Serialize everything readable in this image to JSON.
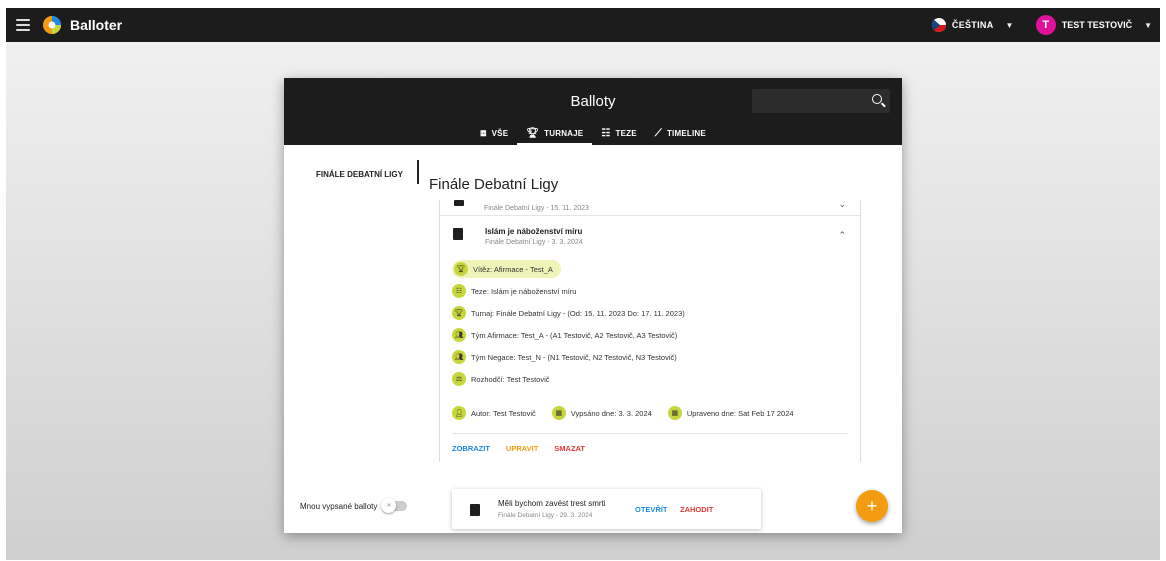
{
  "app": {
    "title": "Balloter",
    "language": "ČEŠTINA",
    "user_initial": "T",
    "user_name": "TEST TESTOVIČ"
  },
  "dialog": {
    "title": "Balloty",
    "search_placeholder": "",
    "tabs": [
      {
        "icon": "view-all-icon",
        "label": "VŠE"
      },
      {
        "icon": "trophy-icon",
        "label": "TURNAJE",
        "active": true
      },
      {
        "icon": "thesis-icon",
        "label": "TEZE"
      },
      {
        "icon": "timeline-icon",
        "label": "TIMELINE"
      }
    ],
    "sidebar_item": "FINÁLE DEBATNÍ LIGY",
    "section_title": "Finále Debatní Ligy"
  },
  "ballots": [
    {
      "subtitle": "Finále Debatní Ligy - 15. 11. 2023",
      "expanded": false
    },
    {
      "title": "Islám je náboženství míru",
      "subtitle": "Finále Debatní Ligy - 3. 3. 2024",
      "expanded": true,
      "winner": "Vítěz: Afirmace - Test_A",
      "thesis": "Teze: Islám je náboženství míru",
      "tournament": "Turnaj: Finále Debatní Ligy - (Od: 15. 11. 2023 Do: 17. 11. 2023)",
      "team_aff": "Tým Afirmace: Test_A - (A1 Testovič, A2 Testovič, A3 Testovič)",
      "team_neg": "Tým Negace: Test_N - (N1 Testovič, N2 Testovič, N3 Testovič)",
      "judge": "Rozhodčí: Test Testovič",
      "author": "Autor: Test Testovič",
      "written": "Vypsáno dne: 3. 3. 2024",
      "updated": "Upraveno dne: Sat Feb 17 2024",
      "actions": {
        "show": "ZOBRAZIT",
        "edit": "UPRAVIT",
        "delete": "SMAZAT"
      }
    }
  ],
  "footer": {
    "toggle_label": "Mnou vypsané balloty",
    "draft_title": "Měli bychom zavést trest smrti",
    "draft_subtitle": "Finále Debatní Ligy - 29. 3. 2024",
    "draft_open": "OTEVŘÍT",
    "draft_discard": "ZAHODIT",
    "fab": "+"
  },
  "colors": {
    "appbar": "#1c1c1c",
    "accent_lime": "#c7d63a",
    "fab_orange": "#f39c12",
    "link_blue": "#1e88e5",
    "danger_red": "#e53935",
    "avatar_pink": "#e0109c"
  }
}
